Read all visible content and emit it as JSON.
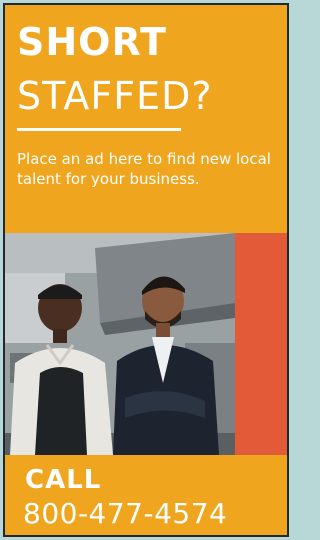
{
  "ad": {
    "headline_line1": "SHORT",
    "headline_line2": "STAFFED?",
    "subtext": "Place an ad here to find new local talent for your business.",
    "call_label": "CALL",
    "phone": "800-477-4574",
    "photo_alt": "Two smiling restaurant workers standing in a commercial kitchen"
  },
  "colors": {
    "page_background": "#b7d8d6",
    "ad_background": "#f0a51f",
    "accent_bar": "#e25a38",
    "text": "#ffffff"
  }
}
